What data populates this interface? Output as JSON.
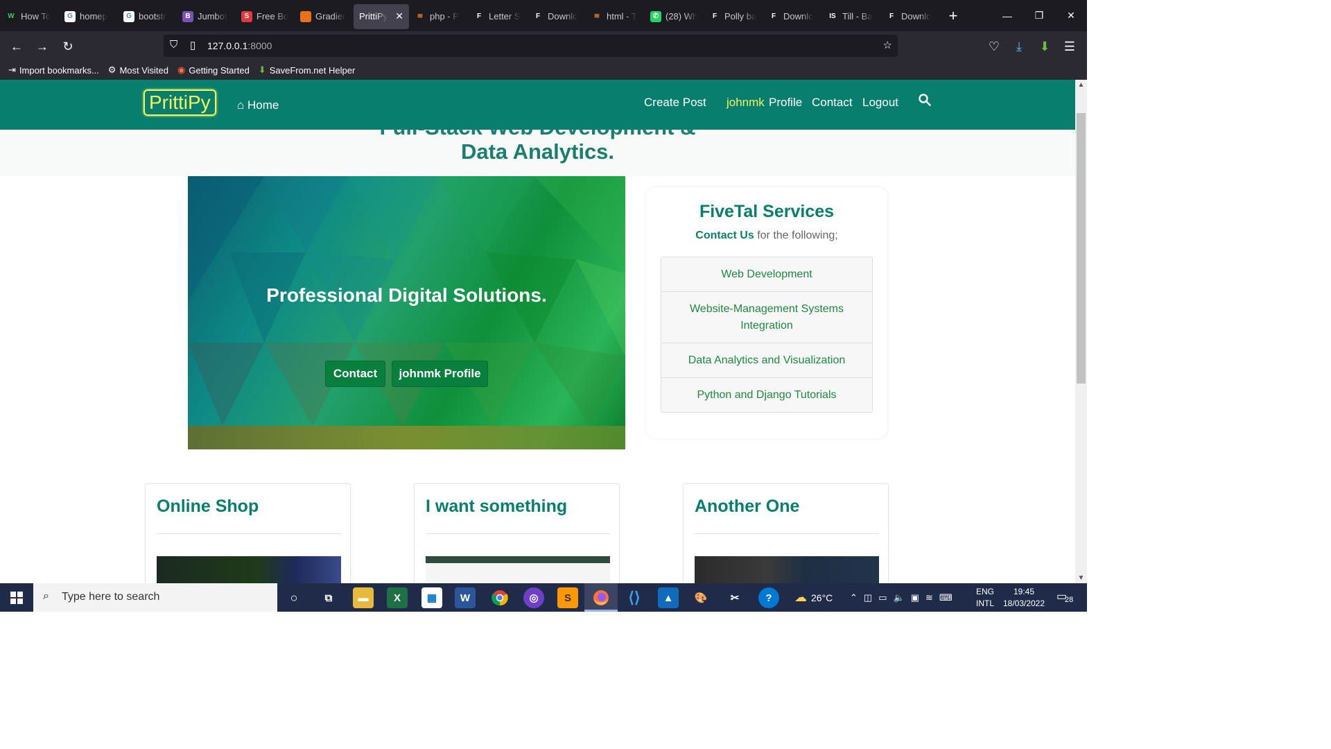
{
  "browser": {
    "tabs": [
      {
        "label": "How To",
        "fav": "W",
        "color": "#1a1a1a",
        "fg": "#37c871"
      },
      {
        "label": "homep",
        "fav": "G",
        "color": "#ffffff",
        "fg": "#4285f4"
      },
      {
        "label": "bootstr",
        "fav": "G",
        "color": "#ffffff",
        "fg": "#4285f4"
      },
      {
        "label": "Jumbot",
        "fav": "B",
        "color": "#7952b3",
        "fg": "#ffffff"
      },
      {
        "label": "Free Bo",
        "fav": "S",
        "color": "#e03a3e",
        "fg": "#ffffff"
      },
      {
        "label": "Gradier",
        "fav": "",
        "color": "#e8711c",
        "fg": "#ffffff"
      },
      {
        "label": "PrittiPy",
        "fav": "",
        "color": "",
        "fg": "",
        "active": true
      },
      {
        "label": "php - P",
        "fav": "≋",
        "color": "",
        "fg": "#f48024"
      },
      {
        "label": "Letter S",
        "fav": "F",
        "color": "",
        "fg": "#ffffff"
      },
      {
        "label": "Downlo",
        "fav": "F",
        "color": "",
        "fg": "#ffffff"
      },
      {
        "label": "html - T",
        "fav": "≋",
        "color": "",
        "fg": "#f48024"
      },
      {
        "label": "(28) Wh",
        "fav": "✆",
        "color": "#25d366",
        "fg": "#ffffff"
      },
      {
        "label": "Polly ba",
        "fav": "F",
        "color": "",
        "fg": "#ffffff"
      },
      {
        "label": "Downlo",
        "fav": "F",
        "color": "",
        "fg": "#ffffff"
      },
      {
        "label": "Till - Ba",
        "fav": "IS",
        "color": "",
        "fg": "#ffffff"
      },
      {
        "label": "Downlo",
        "fav": "F",
        "color": "",
        "fg": "#ffffff"
      }
    ],
    "new_tab": "+",
    "url_host": "127.0.0.1",
    "url_port": ":8000",
    "bookmarks": [
      {
        "label": "Import bookmarks...",
        "icon": "⇥"
      },
      {
        "label": "Most Visited",
        "icon": "⚙"
      },
      {
        "label": "Getting Started",
        "icon": "◉"
      },
      {
        "label": "SaveFrom.net Helper",
        "icon": "⬇"
      }
    ]
  },
  "site": {
    "brand": "PrittiPy",
    "home": "Home",
    "nav": {
      "create_post": "Create Post",
      "username": "johnmk",
      "profile": "Profile",
      "contact": "Contact",
      "logout": "Logout"
    },
    "hero_title_top": "Full-Stack Web Development &",
    "hero_title_bottom": "Data Analytics.",
    "carousel": {
      "title": "Professional Digital Solutions.",
      "btn_contact": "Contact",
      "btn_profile": "johnmk Profile"
    },
    "services": {
      "title": "FiveTal Services",
      "contact_us": "Contact Us",
      "sub_rest": " for the following;",
      "items": [
        "Web Development",
        "Website-Management Systems Integration",
        "Data Analytics and Visualization",
        "Python and Django Tutorials"
      ]
    },
    "cards": [
      {
        "title": "Online Shop"
      },
      {
        "title": "I want something"
      },
      {
        "title": "Another One"
      }
    ]
  },
  "taskbar": {
    "search_placeholder": "Type here to search",
    "weather": "26°C",
    "lang_top": "ENG",
    "lang_bottom": "INTL",
    "time": "19:45",
    "date": "18/03/2022",
    "notifications": "28"
  }
}
